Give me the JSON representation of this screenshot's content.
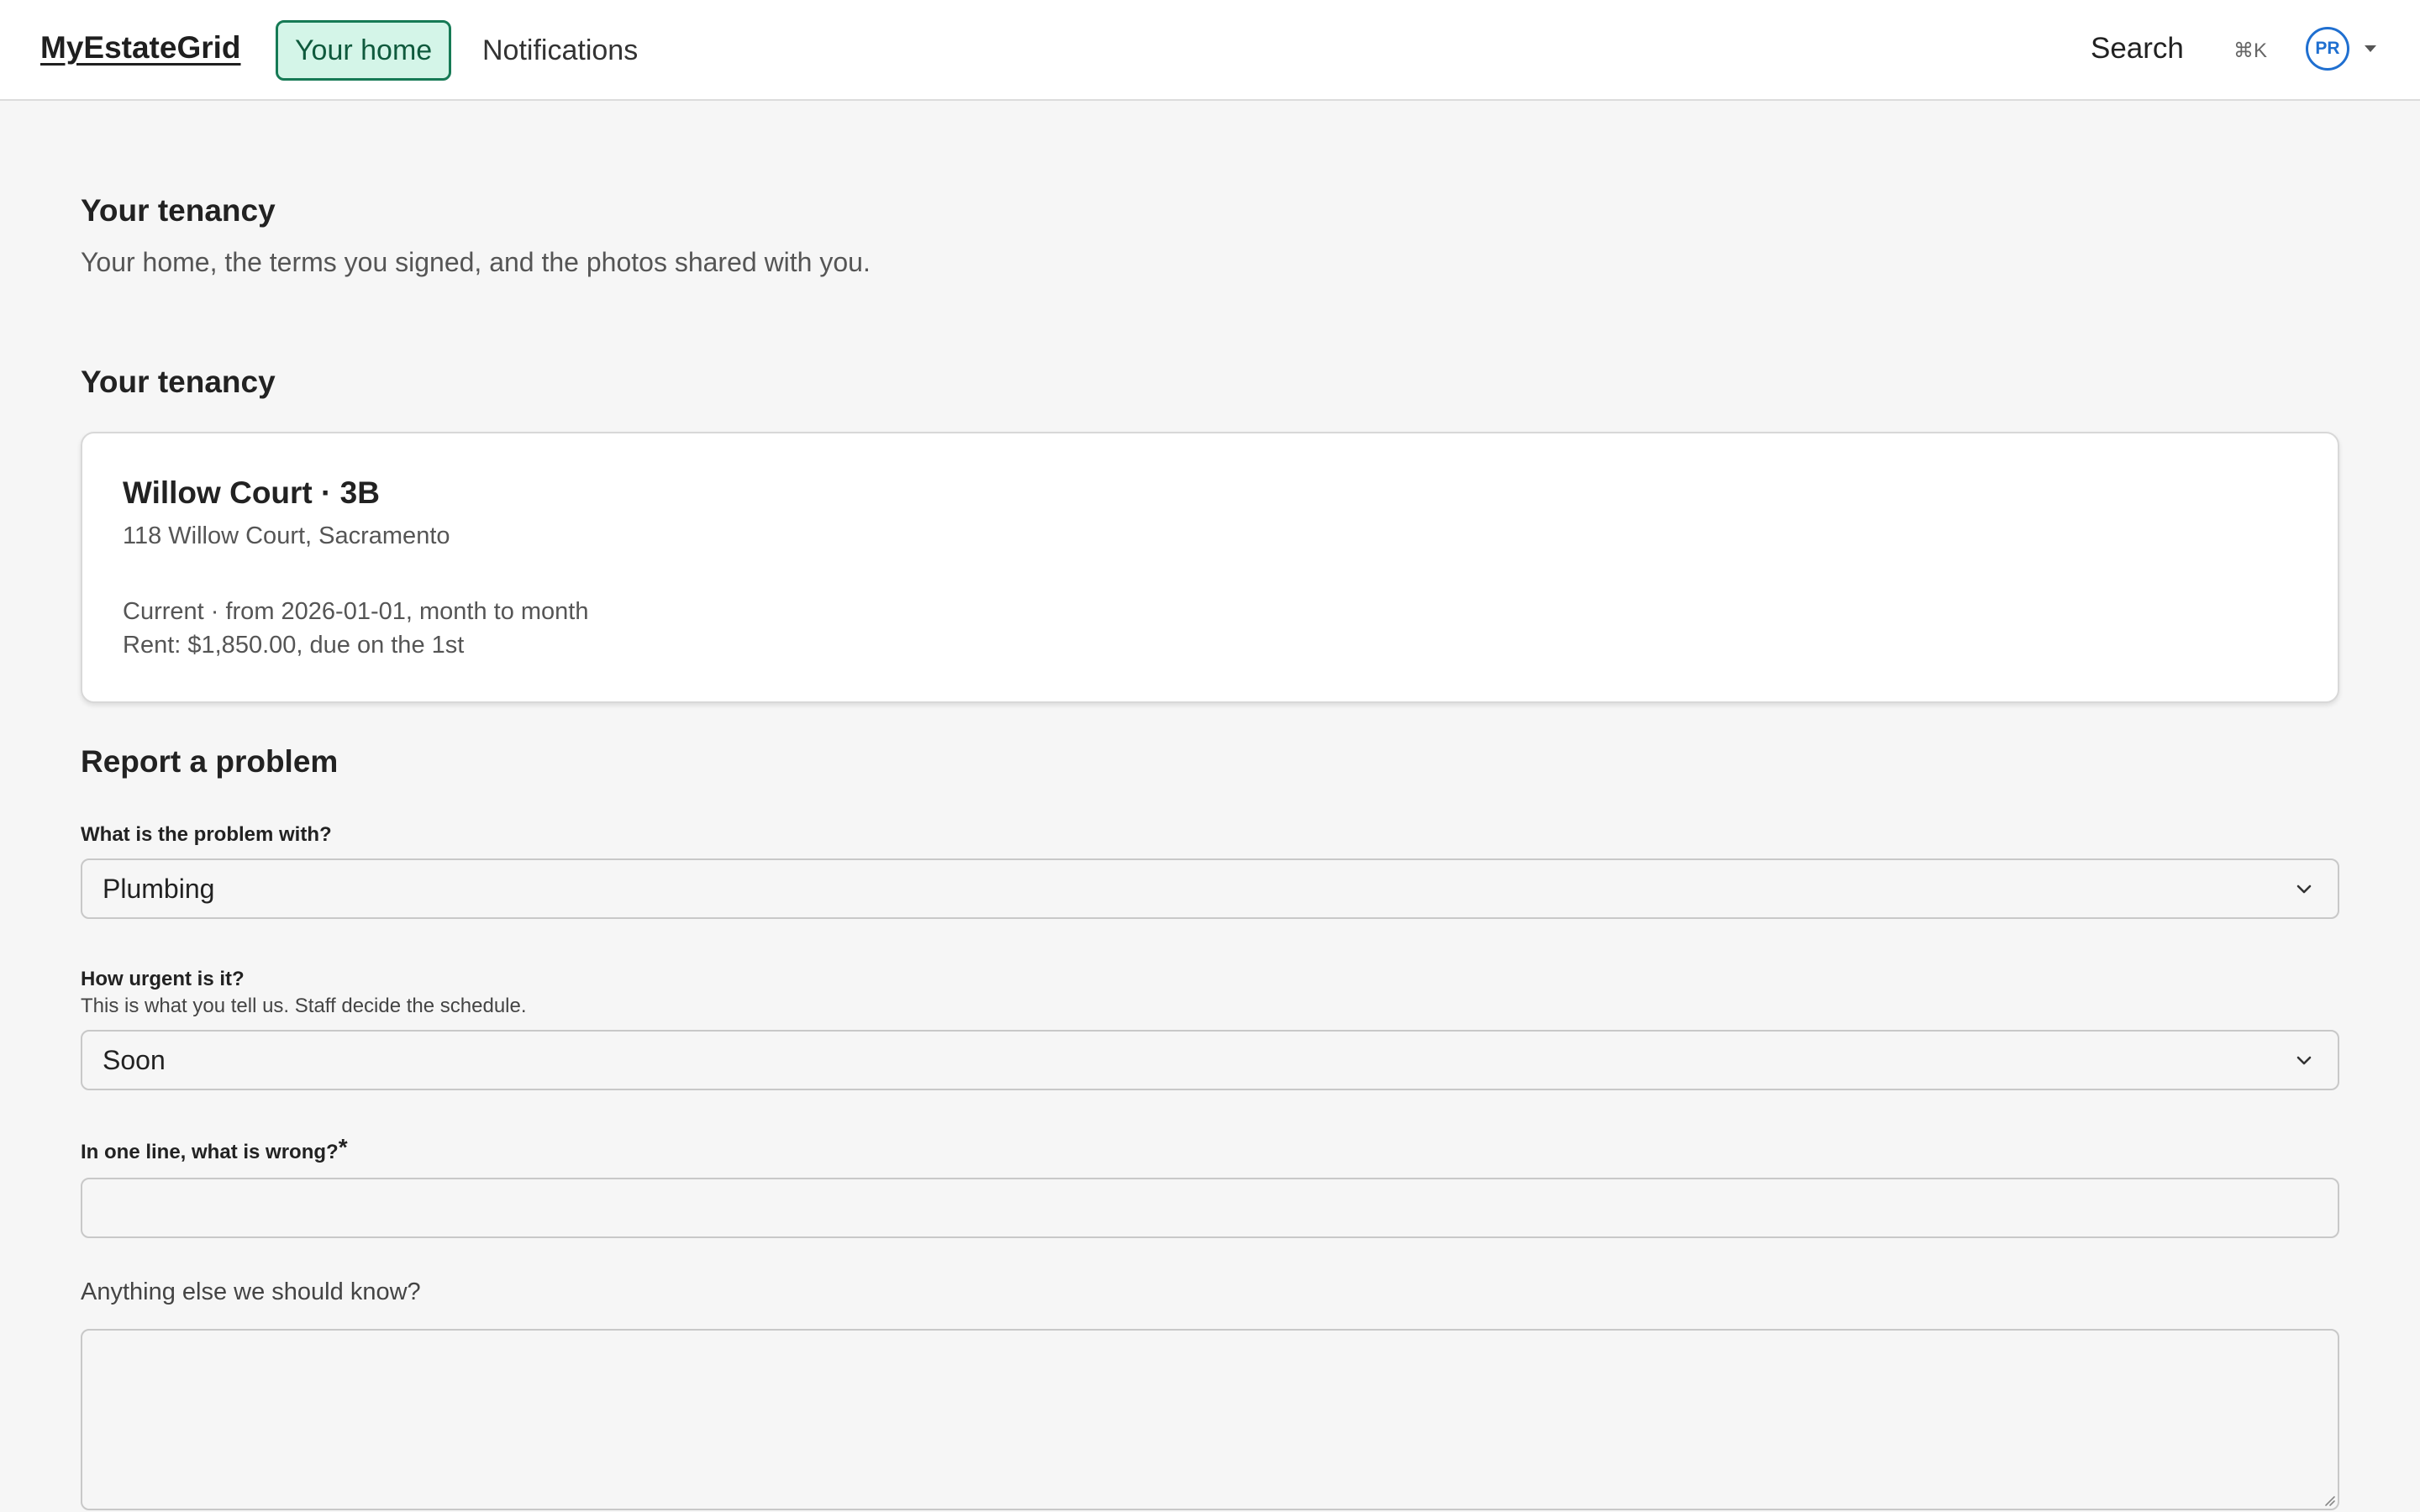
{
  "app": {
    "name": "MyEstateGrid"
  },
  "nav": {
    "tabs": [
      {
        "label": "Your home",
        "active": true
      },
      {
        "label": "Notifications",
        "active": false
      }
    ],
    "search_label": "Search",
    "search_shortcut": "⌘K",
    "user_initials": "PR"
  },
  "page": {
    "title": "Your tenancy",
    "subtitle": "Your home, the terms you signed, and the photos shared with you."
  },
  "tenancy": {
    "heading": "Your tenancy",
    "property_title": "Willow Court · 3B",
    "address": "118 Willow Court, Sacramento",
    "status_line": "Current · from 2026-01-01, month to month",
    "rent_line": "Rent: $1,850.00, due on the 1st"
  },
  "report": {
    "heading": "Report a problem",
    "category": {
      "label": "What is the problem with?",
      "value": "Plumbing"
    },
    "urgency": {
      "label": "How urgent is it?",
      "hint": "This is what you tell us. Staff decide the schedule.",
      "value": "Soon"
    },
    "summary": {
      "label": "In one line, what is wrong?",
      "required_mark": "*",
      "value": ""
    },
    "details": {
      "label": "Anything else we should know?",
      "value": ""
    }
  },
  "colors": {
    "accent_green": "#167a55",
    "active_tab_bg": "#d4f5e8",
    "avatar_blue": "#1f6fd0",
    "page_bg": "#f6f6f6"
  }
}
